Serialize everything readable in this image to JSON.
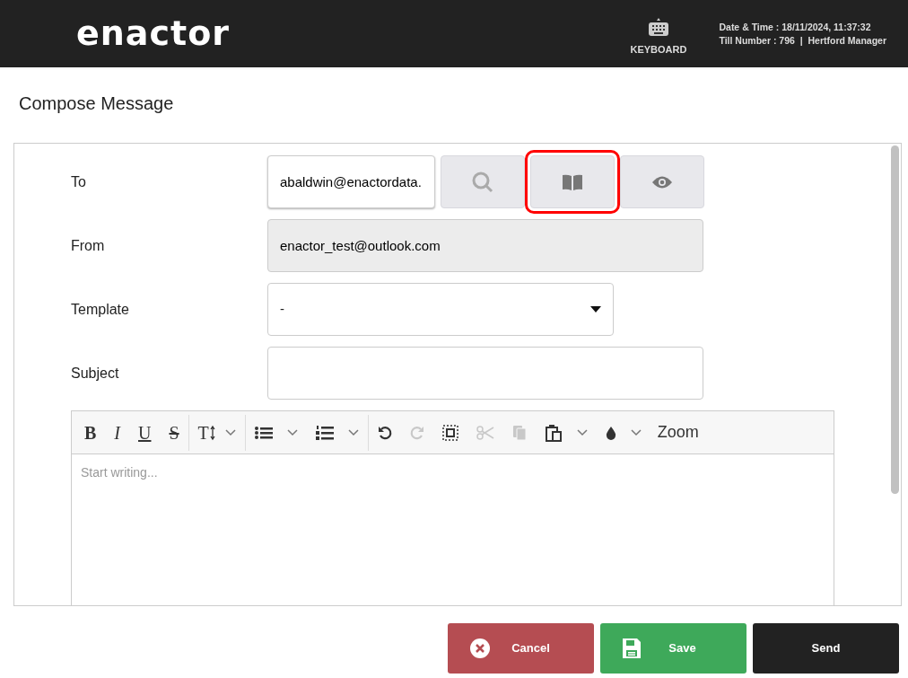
{
  "header": {
    "logo": "enactor",
    "keyboard": "KEYBOARD",
    "info": [
      "Date & Time : 18/11/2024, 11:37:32",
      "Till Number : 796  |  Hertford Manager"
    ]
  },
  "title": "Compose Message",
  "form": {
    "to": {
      "label": "To",
      "value": "abaldwin@enactordata.",
      "buttons": [
        {
          "kind": "search",
          "highlighted": false
        },
        {
          "kind": "book",
          "highlighted": true
        },
        {
          "kind": "eye",
          "highlighted": false
        }
      ]
    },
    "from": {
      "label": "From",
      "value": "enactor_test@outlook.com"
    },
    "template": {
      "label": "Template",
      "value": "-"
    },
    "subject": {
      "label": "Subject"
    }
  },
  "editor": {
    "placeholder": "Start writing...",
    "zoom": "Zoom",
    "tools": [
      {
        "kind": "bold",
        "glyph": "B",
        "disabled": false,
        "dropdown": false
      },
      {
        "kind": "italic",
        "glyph": "I",
        "disabled": false,
        "dropdown": false
      },
      {
        "kind": "underline",
        "glyph": "U",
        "disabled": false,
        "dropdown": false
      },
      {
        "kind": "strike",
        "glyph": "S",
        "disabled": false,
        "dropdown": false
      },
      {
        "kind": "sep"
      },
      {
        "kind": "fontsize",
        "glyph": "T",
        "disabled": false,
        "dropdown": true
      },
      {
        "kind": "sep"
      },
      {
        "kind": "bullets",
        "disabled": false,
        "dropdown": true
      },
      {
        "kind": "numbers",
        "disabled": false,
        "dropdown": true
      },
      {
        "kind": "sep"
      },
      {
        "kind": "undo",
        "disabled": false,
        "dropdown": false
      },
      {
        "kind": "redo",
        "disabled": true,
        "dropdown": false
      },
      {
        "kind": "selectall",
        "disabled": false,
        "dropdown": false
      },
      {
        "kind": "cut",
        "disabled": true,
        "dropdown": false
      },
      {
        "kind": "copy",
        "disabled": true,
        "dropdown": false
      },
      {
        "kind": "paste",
        "disabled": false,
        "dropdown": true
      },
      {
        "kind": "color",
        "disabled": false,
        "dropdown": true
      }
    ]
  },
  "actions": [
    {
      "kind": "cancel",
      "label": "Cancel"
    },
    {
      "kind": "save",
      "label": "Save"
    },
    {
      "kind": "send",
      "label": "Send"
    }
  ]
}
